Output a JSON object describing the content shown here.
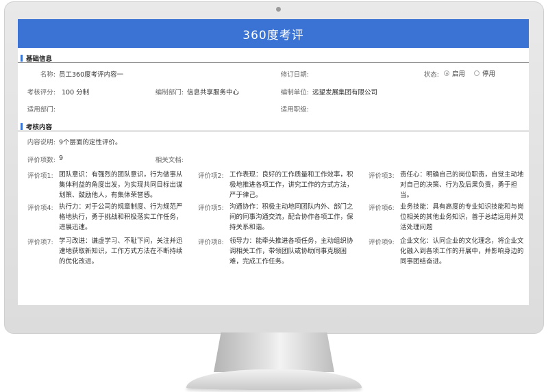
{
  "title": "360度考评",
  "basic": {
    "heading": "基础信息",
    "name_label": "名称:",
    "name_value": "员工360度考评内容一",
    "revision_label": "修订日期:",
    "revision_value": "",
    "status_label": "状态:",
    "status_options": [
      "启用",
      "停用"
    ],
    "status_selected": "启用",
    "score_label": "考核评分:",
    "score_value": "100  分制",
    "dept_label": "编制部门:",
    "dept_value": "信息共享服务中心",
    "unit_label": "编制单位:",
    "unit_value": "远望发展集团有限公司",
    "apply_dept_label": "适用部门:",
    "apply_dept_value": "",
    "apply_post_label": "适用职级:",
    "apply_post_value": ""
  },
  "content": {
    "heading": "考核内容",
    "desc_label": "内容说明:",
    "desc_value": "9个层面的定性评价。",
    "count_label": "评价项数:",
    "count_value": "9",
    "doc_label": "相关文档:",
    "doc_value": "",
    "items": [
      {
        "label": "评价项1:",
        "text": "团队意识：有强烈的团队意识，行为做事从集体利益的角度出发，为实现共同目标出谋划策、鼓励他人，有集体荣誉感。"
      },
      {
        "label": "评价项2:",
        "text": "工作表现：良好的工作质量和工作效率，积极地推进各项工作，讲究工作的方式方法，严于律己。"
      },
      {
        "label": "评价项3:",
        "text": "责任心：明确自己的岗位职责，自觉主动地对自己的决策、行为及后果负责，勇于担当。"
      },
      {
        "label": "评价项4:",
        "text": "执行力：对于公司的规章制度、行为规范严格地执行，勇于挑战和积极落实工作任务，进展迅速。"
      },
      {
        "label": "评价项5:",
        "text": "沟通协作：积极主动地同团队内外、部门之间的同事沟通交流，配合协作各项工作，保持关系和谐。"
      },
      {
        "label": "评价项6:",
        "text": "业务技能：具有高度的专业知识技能和与岗位相关的其他业务知识，善于总结运用并灵活处理问题"
      },
      {
        "label": "评价项7:",
        "text": "学习改进：谦虚学习、不耻下问，关注并迅速地获取新知识，工作方式方法在不断持续的优化改进。"
      },
      {
        "label": "评价项8:",
        "text": "领导力：能牵头推进各项任务，主动组织协调相关工作，带领团队或协助同事克服困难，完成工作任务。"
      },
      {
        "label": "评价项9:",
        "text": "企业文化：认同企业的文化理念，将企业文化融入到各项工作的开展中，并影响身边的同事团结奋进。"
      }
    ]
  }
}
